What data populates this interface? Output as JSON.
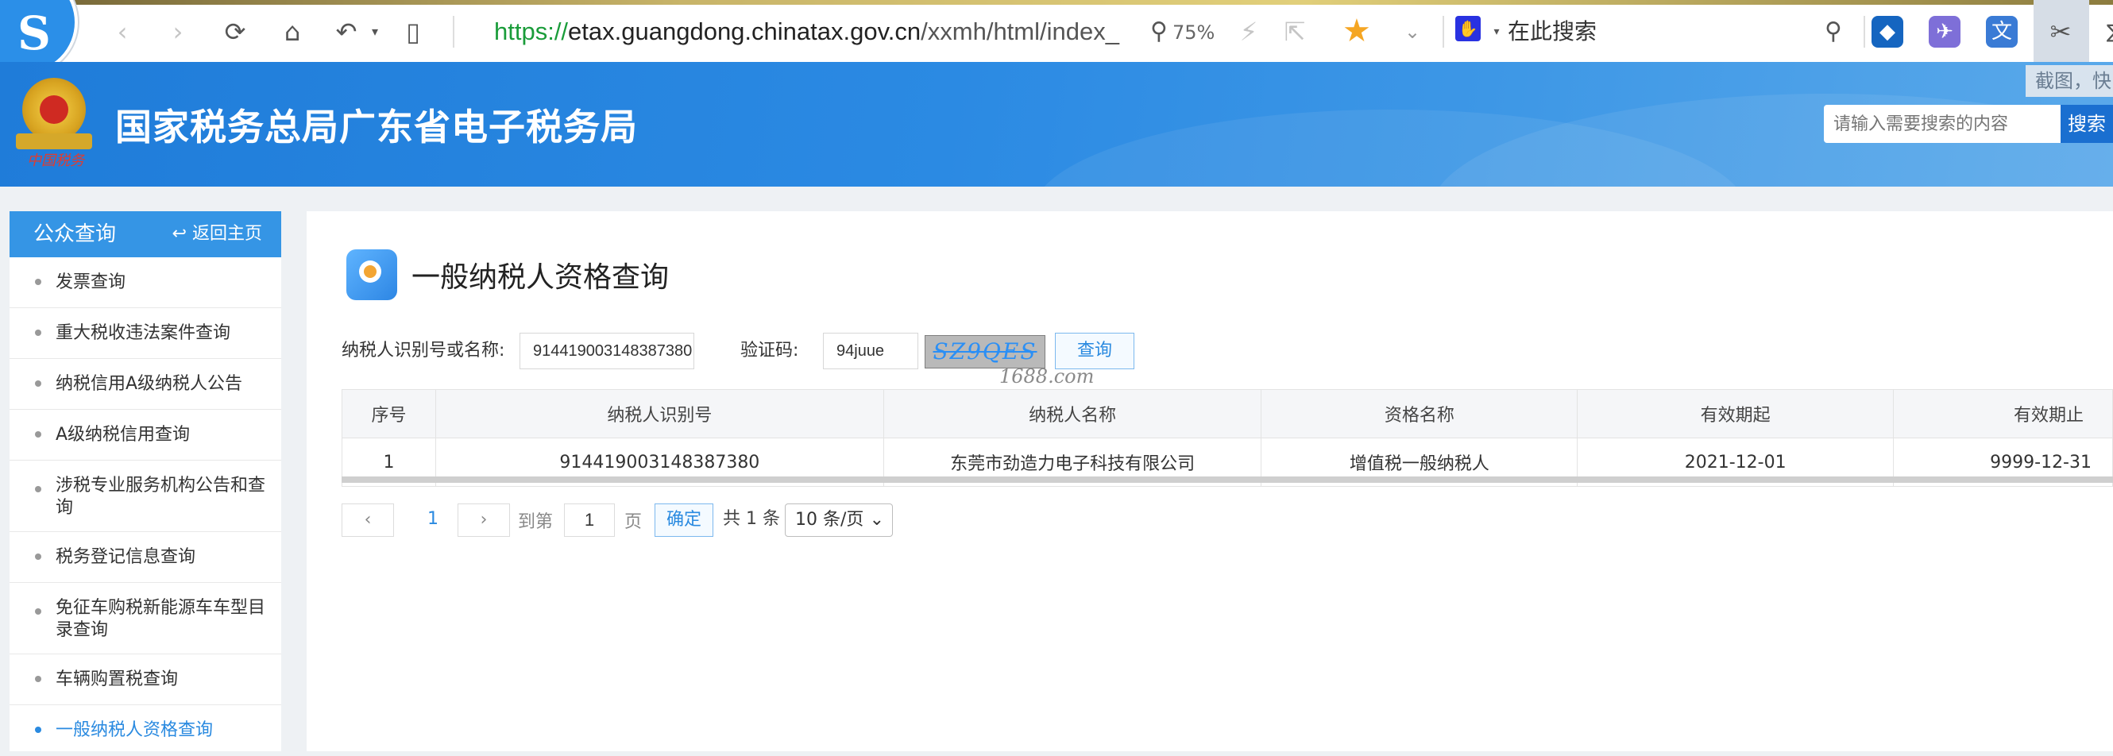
{
  "browser": {
    "url_scheme": "https://",
    "url_host": "etax.guangdong.chinatax.gov.cn",
    "url_path": "/xxmh/html/index_",
    "zoom": "75%",
    "search_placeholder": "在此搜索",
    "tooltip_text": "截图，快",
    "colors": {
      "accent": "#2b8fe8",
      "star": "#f5a623",
      "url_scheme": "#1a9c3a"
    }
  },
  "header": {
    "site_title": "国家税务总局广东省电子税务局",
    "emblem_signature": "中国税务",
    "search_placeholder": "请输入需要搜索的内容",
    "search_button": "搜索",
    "color": "#2b8ae3"
  },
  "sidebar": {
    "title": "公众查询",
    "back_label": "返回主页",
    "items": [
      {
        "label": "发票查询"
      },
      {
        "label": "重大税收违法案件查询"
      },
      {
        "label": "纳税信用A级纳税人公告"
      },
      {
        "label": "A级纳税信用查询"
      },
      {
        "label": "涉税专业服务机构公告和查询"
      },
      {
        "label": "税务登记信息查询"
      },
      {
        "label": "免征车购税新能源车车型目录查询"
      },
      {
        "label": "车辆购置税查询"
      },
      {
        "label": "一般纳税人资格查询"
      }
    ]
  },
  "main": {
    "page_title": "一般纳税人资格查询",
    "form": {
      "taxpayer_label": "纳税人识别号或名称:",
      "taxpayer_value": "914419003148387380",
      "captcha_label": "验证码:",
      "captcha_value": "94juue",
      "captcha_image_text": "SZ9QES",
      "watermark": "1688.com",
      "query_button": "查询"
    },
    "table": {
      "columns": [
        "序号",
        "纳税人识别号",
        "纳税人名称",
        "资格名称",
        "有效期起",
        "有效期止"
      ],
      "rows": [
        [
          "1",
          "914419003148387380",
          "东莞市劲造力电子科技有限公司",
          "增值税一般纳税人",
          "2021-12-01",
          "9999-12-31"
        ]
      ]
    },
    "pagination": {
      "current_page": "1",
      "goto_prefix": "到第",
      "goto_value": "1",
      "goto_suffix": "页",
      "confirm": "确定",
      "total": "共 1 条",
      "page_size": "10 条/页"
    }
  }
}
